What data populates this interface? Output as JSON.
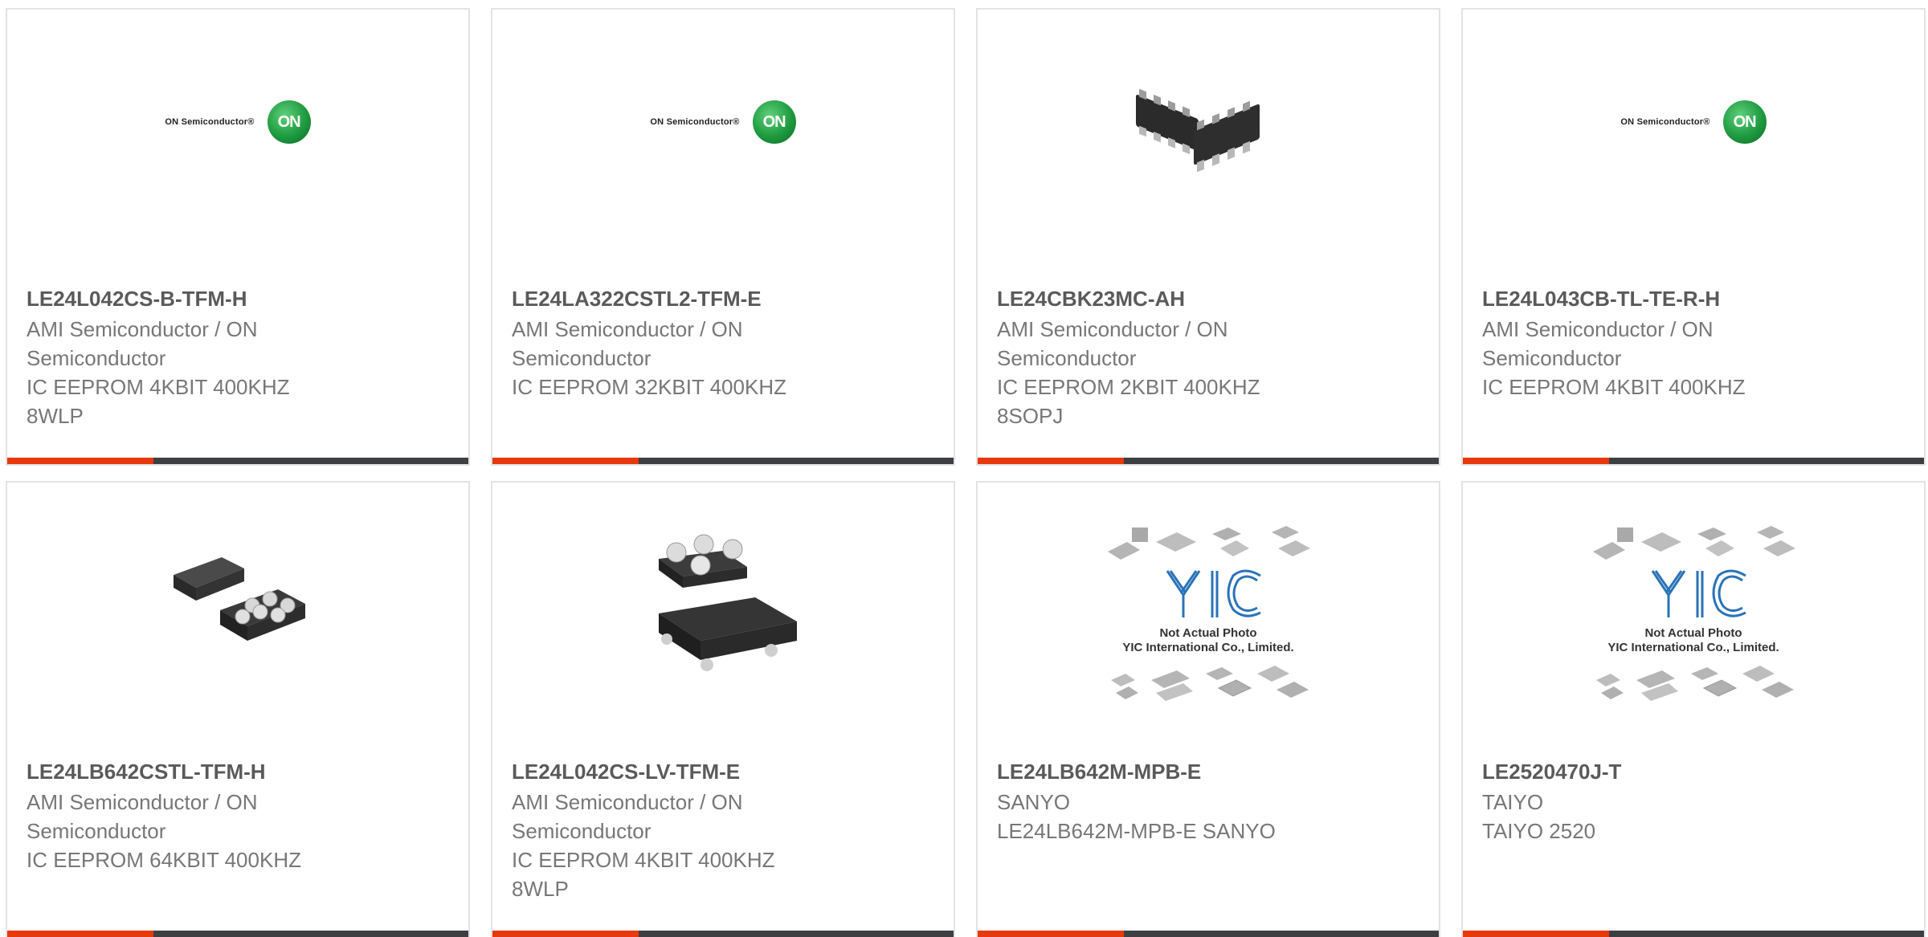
{
  "products": [
    {
      "part": "LE24L042CS-B-TFM-H",
      "desc_lines": [
        "AMI Semiconductor / ON",
        "Semiconductor",
        "IC EEPROM 4KBIT 400KHZ",
        "8WLP"
      ],
      "image": "on-semi-logo",
      "logo_text": "ON Semiconductor®",
      "logo_mark": "ON"
    },
    {
      "part": "LE24LA322CSTL2-TFM-E",
      "desc_lines": [
        "AMI Semiconductor / ON",
        "Semiconductor",
        "IC EEPROM 32KBIT 400KHZ"
      ],
      "image": "on-semi-logo",
      "logo_text": "ON Semiconductor®",
      "logo_mark": "ON"
    },
    {
      "part": "LE24CBK23MC-AH",
      "desc_lines": [
        "AMI Semiconductor / ON",
        "Semiconductor",
        "IC EEPROM 2KBIT 400KHZ",
        "8SOPJ"
      ],
      "image": "soic-chip-photo"
    },
    {
      "part": "LE24L043CB-TL-TE-R-H",
      "desc_lines": [
        "AMI Semiconductor / ON",
        "Semiconductor",
        "IC EEPROM 4KBIT 400KHZ"
      ],
      "image": "on-semi-logo",
      "logo_text": "ON Semiconductor®",
      "logo_mark": "ON"
    },
    {
      "part": "LE24LB642CSTL-TFM-H",
      "desc_lines": [
        "AMI Semiconductor / ON",
        "Semiconductor",
        "IC EEPROM 64KBIT 400KHZ"
      ],
      "image": "wlp-chip-photo"
    },
    {
      "part": "LE24L042CS-LV-TFM-E",
      "desc_lines": [
        "AMI Semiconductor / ON",
        "Semiconductor",
        "IC EEPROM 4KBIT 400KHZ",
        "8WLP"
      ],
      "image": "wlp-chip-photo-2"
    },
    {
      "part": "LE24LB642M-MPB-E",
      "desc_lines": [
        "SANYO",
        "LE24LB642M-MPB-E SANYO"
      ],
      "image": "yic-placeholder",
      "placeholder_line1": "Not Actual Photo",
      "placeholder_line2": "YIC International Co., Limited."
    },
    {
      "part": "LE2520470J-T",
      "desc_lines": [
        "TAIYO",
        "TAIYO 2520"
      ],
      "image": "yic-placeholder",
      "placeholder_line1": "Not Actual Photo",
      "placeholder_line2": "YIC International Co., Limited."
    }
  ],
  "colors": {
    "accent": "#e8380d",
    "bar": "#3d3f42",
    "part_text": "#5a5a5a",
    "desc_text": "#777777"
  }
}
